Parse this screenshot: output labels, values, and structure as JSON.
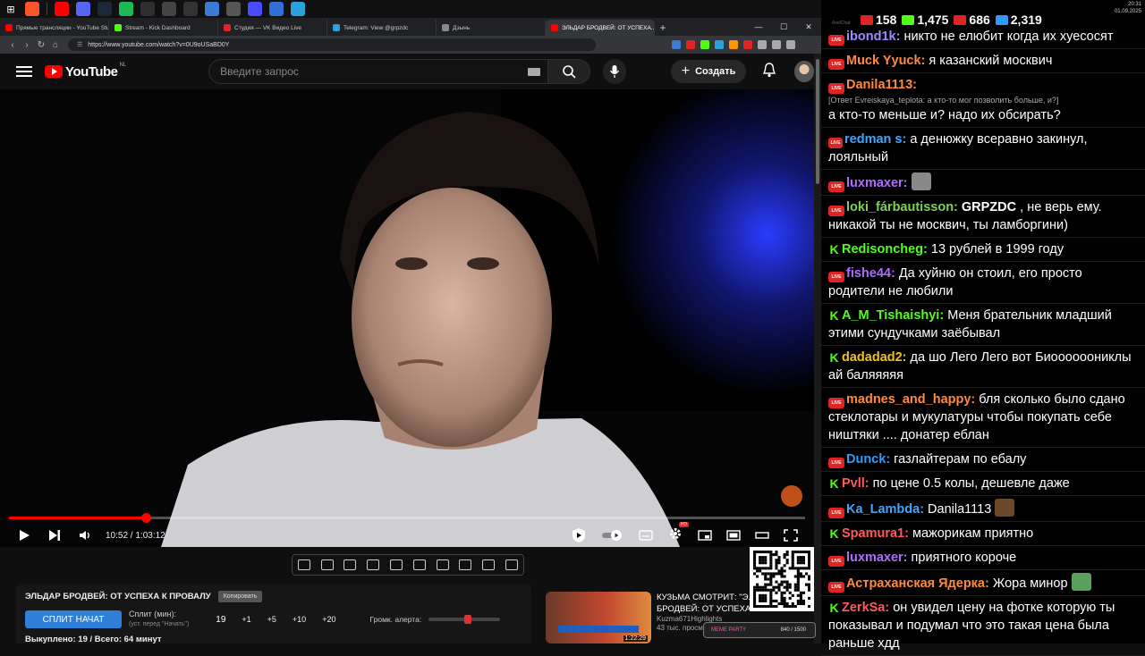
{
  "taskbar": {
    "icons": [
      {
        "name": "brave-icon",
        "color": "#fb542b"
      },
      {
        "name": "youtube-icon",
        "color": "#ff0000"
      },
      {
        "name": "discord-icon",
        "color": "#5865f2"
      },
      {
        "name": "steam-icon",
        "color": "#1b2838"
      },
      {
        "name": "spotify-icon",
        "color": "#1db954"
      },
      {
        "name": "obs-icon",
        "color": "#302e31"
      },
      {
        "name": "media-icon",
        "color": "#444444"
      },
      {
        "name": "close-app-icon",
        "color": "#333333"
      },
      {
        "name": "app-icon",
        "color": "#3a7bd5"
      },
      {
        "name": "folder-icon",
        "color": "#555555"
      },
      {
        "name": "player-icon",
        "color": "#4a4aff"
      },
      {
        "name": "mail-icon",
        "color": "#2f6fd6"
      },
      {
        "name": "telegram-icon",
        "color": "#2aa1da"
      }
    ]
  },
  "browser": {
    "tabs": [
      {
        "label": "Прямые трансляции - YouTube Studio",
        "color": "#ff0000",
        "active": false
      },
      {
        "label": "Stream - Kick Dashboard",
        "color": "#53fc18",
        "active": false
      },
      {
        "label": "Студия — VK Видео Live",
        "color": "#e02424",
        "active": false
      },
      {
        "label": "Telegram: View @grpzdc",
        "color": "#2aa1da",
        "active": false
      },
      {
        "label": "Дзынь",
        "color": "#888888",
        "active": false
      },
      {
        "label": "ЭЛЬДАР БРОДВЕЙ: ОТ УСПЕХА...",
        "color": "#ff0000",
        "active": true
      }
    ],
    "url": "https://www.youtube.com/watch?v=0U9oUSaBD0Y",
    "extension_colors": [
      "#3a7bd5",
      "#e02424",
      "#53fc18",
      "#2aa1da",
      "#ff9800",
      "#e02424",
      "#aaaaaa",
      "#aaaaaa",
      "#aaaaaa"
    ]
  },
  "youtube": {
    "logo_text": "YouTube",
    "country_code": "NL",
    "search_placeholder": "Введите запрос",
    "create_label": "Создать"
  },
  "player": {
    "current_time": "10:52",
    "duration": "1:03:12",
    "time_display": "10:52 / 1:03:12",
    "progress_fraction": 0.172,
    "accent": "#ff0000"
  },
  "panel": {
    "title": "ЭЛЬДАР БРОДВЕЙ: ОТ УСПЕХА К ПРОВАЛУ",
    "copy_label": "Копировать",
    "split_button": "СПЛИТ НАЧАТ",
    "split_label": "Сплит (мин):",
    "split_hint": "(уст. перед \"Начать\")",
    "split_value": "19",
    "increments": [
      "+1",
      "+5",
      "+10",
      "+20"
    ],
    "alert_label": "Громк. алерта:",
    "alert_level": 0.55,
    "status": "Выкуплено: 19 / Всего: 64 минут"
  },
  "recommendation": {
    "title_line1": "КУЗЬМА СМОТРИТ: \"Э...",
    "title_line2": "БРОДВЕЙ: ОТ УСПЕХА К...",
    "channel": "Kuzma671Highlights",
    "meta": "43 тыс. просмотров · 1 день назад",
    "duration": "1:22:29"
  },
  "overlay": {
    "meme_label": "MEME PARTY",
    "meme_count": "840 / 1500"
  },
  "chat": {
    "app_label": "AxelChat",
    "stats": [
      {
        "name": "youtube-viewers",
        "icon": "youtube-icon",
        "color": "#e02424",
        "value": "158"
      },
      {
        "name": "kick-viewers",
        "icon": "kick-icon",
        "color": "#53fc18",
        "value": "1,475"
      },
      {
        "name": "vk-viewers",
        "icon": "vk-icon",
        "color": "#e02424",
        "value": "686"
      },
      {
        "name": "total-viewers",
        "icon": "people-icon",
        "color": "#2f9bff",
        "value": "2,319"
      }
    ],
    "clock_time": "20:31",
    "clock_date": "01.09.2025",
    "messages": [
      {
        "platform": "vk",
        "user": "ibond1k:",
        "color": "#9b8cff",
        "text": " никто не елюбит когда их хуесосят"
      },
      {
        "platform": "vk",
        "user": "Muck Yyuck:",
        "color": "#ff8a3d",
        "text": " я казанский москвич"
      },
      {
        "platform": "vk",
        "user": "Danila1113:",
        "color": "#ff8a3d",
        "reply": "[Ответ Evreiskaya_teplota: а кто-то мог позволить больше, и?]",
        "text": "а кто-то меньше и? надо их обсирать?"
      },
      {
        "platform": "yt",
        "user": "redman s:",
        "color": "#3ea6ff",
        "text": " а денюжку всеравно закинул, лояльный"
      },
      {
        "platform": "vk",
        "user": "luxmaxer:",
        "color": "#b06cff",
        "text": "",
        "emote": "#888888"
      },
      {
        "platform": "vk",
        "user": "loki_fárbautisson:",
        "color": "#7cd15a",
        "bold": "GRPZDC",
        "text": " , не верь ему. никакой ты не москвич, ты ламборгини)"
      },
      {
        "platform": "kick",
        "user": "Redisoncheg:",
        "color": "#53fc18",
        "text": " 13 рублей в 1999 году"
      },
      {
        "platform": "vk",
        "user": "fishe44:",
        "color": "#b06cff",
        "text": " Да хуйню он стоил, его просто родители не любили"
      },
      {
        "platform": "kick",
        "user": "A_M_Tishaishyi:",
        "color": "#53fc18",
        "text": " Меня брательник младший этими сундучками заёбывал"
      },
      {
        "platform": "kick",
        "user": "dadadad2:",
        "color": "#f0c419",
        "text": " да шо Лего Лего вот Биоооооониклы ай баляяяяя"
      },
      {
        "platform": "vk",
        "user": "madnes_and_happy:",
        "color": "#ff8a3d",
        "text": " бля сколько было сдано стеклотары и мукулатуры чтобы покупать себе ништяки .... донатер еблан"
      },
      {
        "platform": "vk",
        "user": "Dunck:",
        "color": "#2f9bff",
        "text": " газлайтерам по ебалу"
      },
      {
        "platform": "kick",
        "user": "Pvll:",
        "color": "#ff5a5a",
        "text": " по цене 0.5 колы, дешевле даже"
      },
      {
        "platform": "vk",
        "user": "Ka_Lambda:",
        "color": "#3ea6ff",
        "text": " Danila1113",
        "emote": "#6b4a2a"
      },
      {
        "platform": "kick",
        "user": "Spamura1:",
        "color": "#ff5a5a",
        "text": " мажорикам приятно"
      },
      {
        "platform": "vk",
        "user": "luxmaxer:",
        "color": "#b06cff",
        "text": " приятного короче"
      },
      {
        "platform": "vk",
        "user": "Астраханская Ядерка:",
        "color": "#ff8a3d",
        "text": " Жора минор",
        "emote": "#5aa05a"
      },
      {
        "platform": "kick",
        "user": "ZerkSa:",
        "color": "#ff5a5a",
        "text": " он увидел цену на фотке которую ты показывал и подумал что это такая цена была раньше хдд"
      }
    ]
  }
}
